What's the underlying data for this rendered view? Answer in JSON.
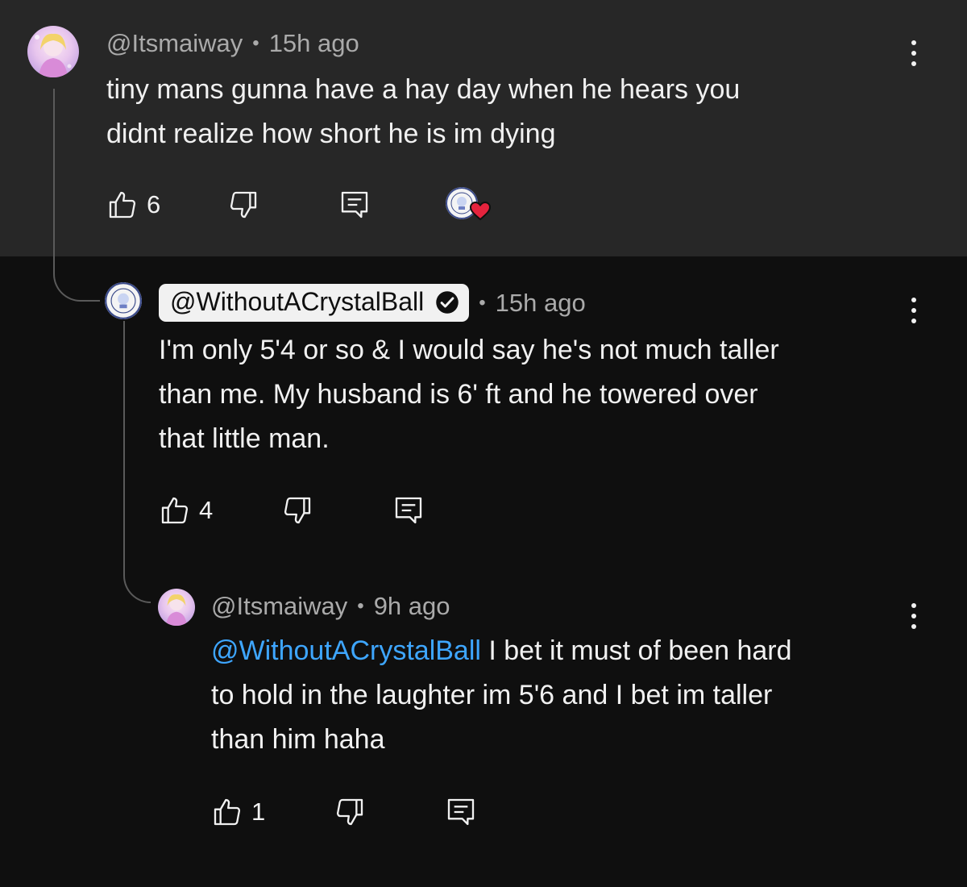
{
  "comments": [
    {
      "author": "@Itsmaiway",
      "time": "15h ago",
      "text_line1": "tiny mans gunna have a hay day when he hears you",
      "text_line2": "didnt realize how short he is im dying",
      "likes": "6",
      "creator_heart": true
    },
    {
      "author": "@WithoutACrystalBall",
      "verified": true,
      "time": "15h ago",
      "text_line1": "I'm only 5'4 or so & I would say he's not much taller",
      "text_line2": "than me. My husband is 6' ft and he towered over",
      "text_line3": "that little man.",
      "likes": "4"
    },
    {
      "author": "@Itsmaiway",
      "time": "9h ago",
      "mention": "@WithoutACrystalBall",
      "text_line1_rest": " I bet it must of been hard",
      "text_line2": "to hold in the laughter im 5'6 and I bet im taller",
      "text_line3": "than him haha",
      "likes": "1"
    }
  ],
  "separator": "•",
  "colors": {
    "background": "#0f0f0f",
    "highlight_band": "#272727",
    "text": "#f1f1f1",
    "meta": "#aaaaaa",
    "mention": "#3ea6ff",
    "heart": "#e5233d"
  },
  "icons": {
    "like": "thumbs-up-icon",
    "dislike": "thumbs-down-icon",
    "reply": "reply-icon",
    "more": "more-vertical-icon",
    "verified": "verified-check-icon",
    "heart": "heart-icon"
  }
}
